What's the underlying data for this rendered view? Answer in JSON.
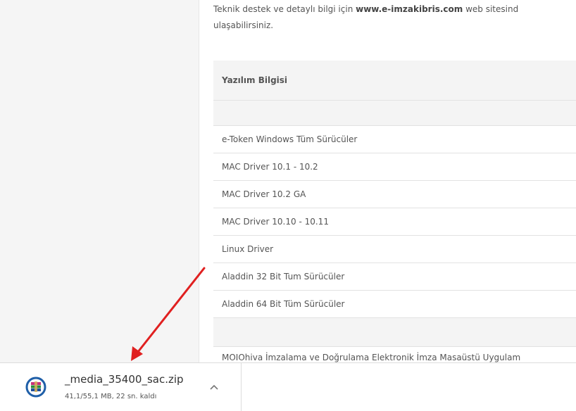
{
  "intro": {
    "text_before": "Teknik destek ve detaylı bilgi için ",
    "link": "www.e-imzakibris.com",
    "text_after": " web sitesind",
    "line2": "ulaşabilirsiniz."
  },
  "table": {
    "header": "Yazılım Bilgisi",
    "rows": [
      "e-Token Windows Tüm Sürücüler",
      "MAC Driver 10.1 - 10.2",
      "MAC Driver 10.2 GA",
      "MAC Driver 10.10 - 10.11",
      "Linux Driver",
      "Aladdin 32 Bit Tum Sürücüler",
      "Aladdin 64 Bit Tüm Sürücüler"
    ],
    "last_row": "MOIOhiva İmzalama ve Doğrulama Elektronik İmza Masaüstü Uygulam"
  },
  "download": {
    "filename": "_media_35400_sac.zip",
    "status": "41,1/55,1 MB, 22 sn. kaldı",
    "icon": "winrar-archive-icon"
  },
  "colors": {
    "annotation_arrow": "#e02020",
    "table_header_bg": "#f4f4f4"
  }
}
